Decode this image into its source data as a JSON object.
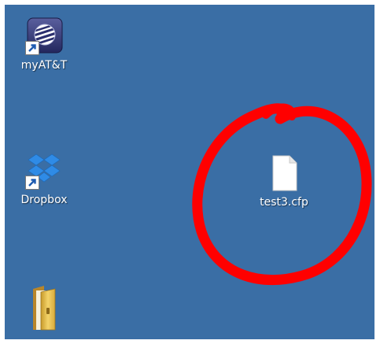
{
  "desktop": {
    "background_color": "#3a6ea5",
    "icons": [
      {
        "label": "myAT&T",
        "icon": "att-globe-icon",
        "shortcut": true
      },
      {
        "label": "Dropbox",
        "icon": "dropbox-icon",
        "shortcut": true
      },
      {
        "label": "",
        "icon": "folder-icon",
        "shortcut": false
      },
      {
        "label": "test3.cfp",
        "icon": "blank-file-icon",
        "shortcut": false
      }
    ]
  },
  "annotation": {
    "type": "hand-drawn circle",
    "color": "#ff0000"
  }
}
